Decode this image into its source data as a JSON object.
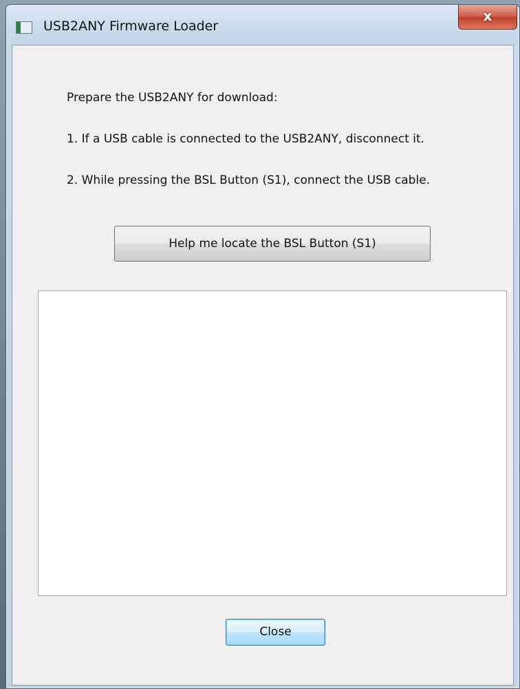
{
  "window": {
    "title": "USB2ANY Firmware Loader",
    "close_glyph": "x"
  },
  "instructions": {
    "heading": "Prepare the USB2ANY for download:",
    "step1": "1. If a USB cable is connected to the USB2ANY, disconnect it.",
    "step2": "2. While pressing the BSL Button (S1), connect the USB cable."
  },
  "buttons": {
    "help_label": "Help me locate the BSL Button (S1)",
    "close_label": "Close"
  },
  "output": {
    "text": ""
  }
}
